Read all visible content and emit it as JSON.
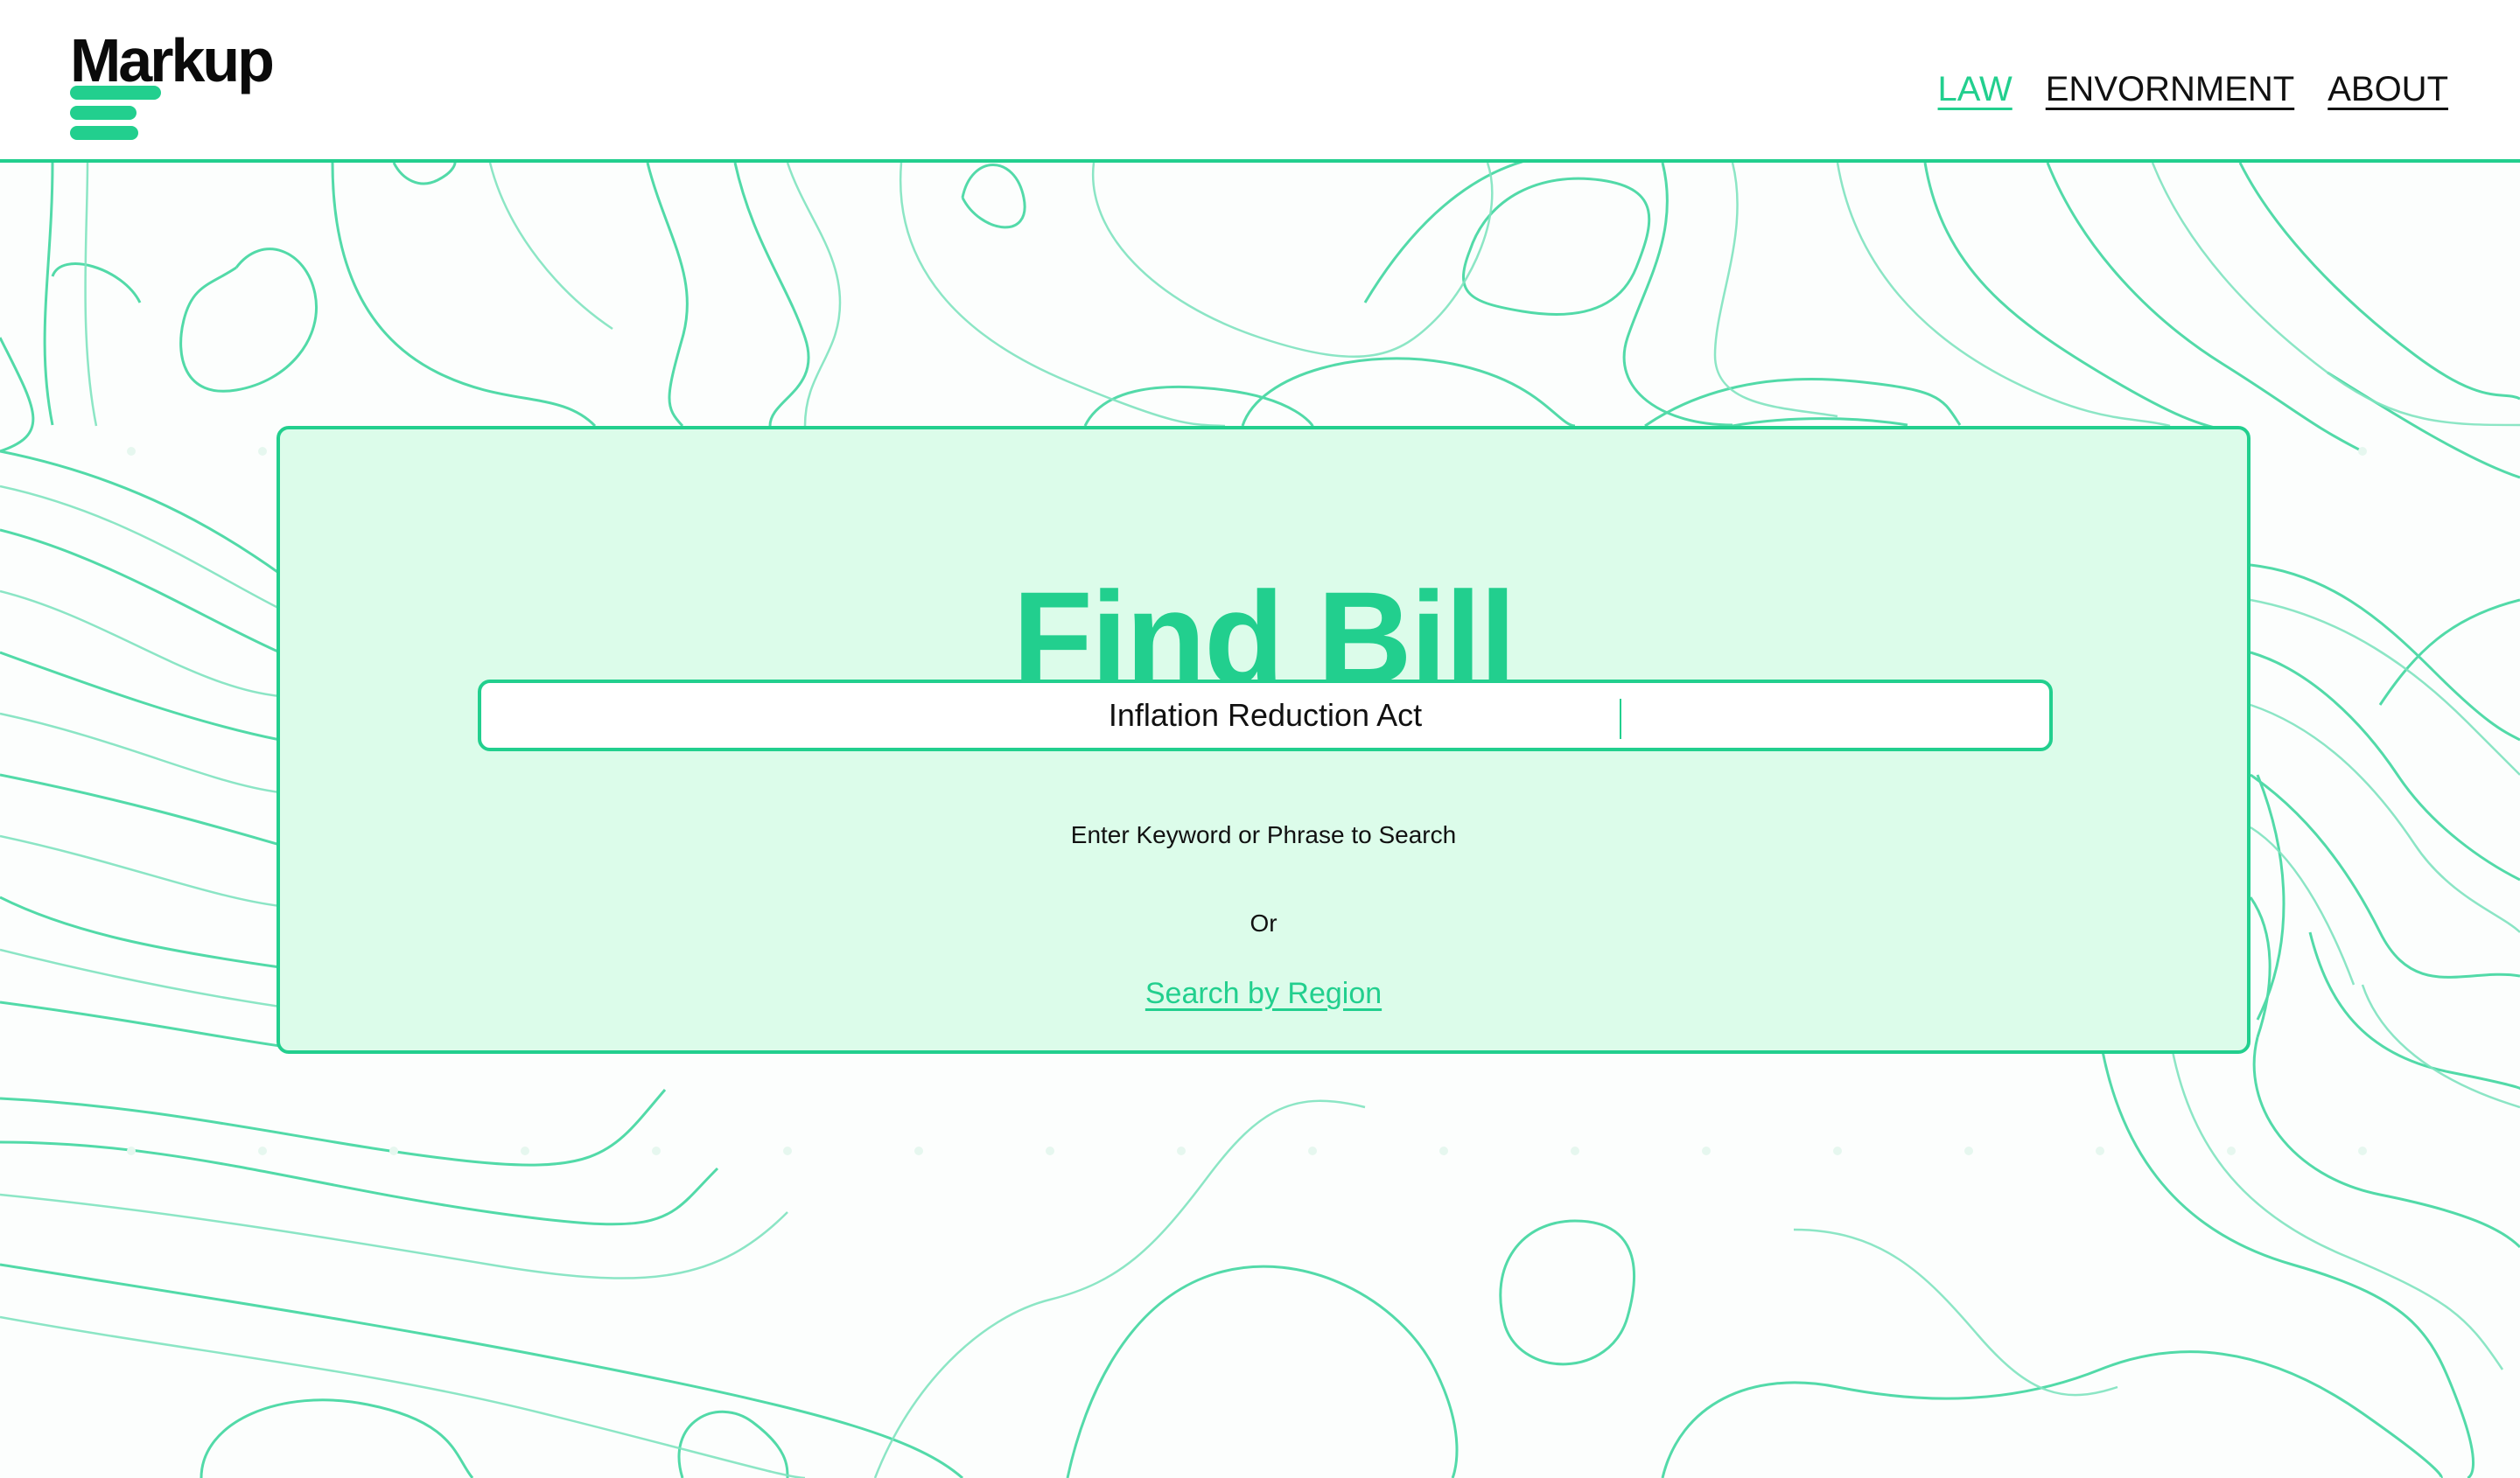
{
  "header": {
    "logo_text": "Markup",
    "nav": [
      {
        "label": "LAW",
        "active": true
      },
      {
        "label": "ENVORNMENT",
        "active": false
      },
      {
        "label": "ABOUT",
        "active": false
      }
    ]
  },
  "search": {
    "title": "Find Bill",
    "input_value": "Inflation Reduction Act",
    "hint": "Enter Keyword or Phrase to Search",
    "or_text": "Or",
    "region_link": "Search by Region"
  },
  "colors": {
    "accent": "#22cf8e",
    "card_bg": "#dcfcea",
    "text": "#111111",
    "background": "#fcfefd"
  },
  "icons": {
    "logo_mark": "three-bars-logo-icon",
    "background": "topographic-contour-pattern"
  }
}
